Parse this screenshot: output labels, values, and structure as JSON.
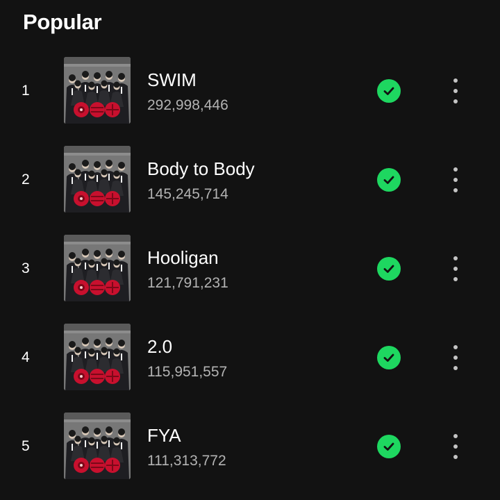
{
  "section": {
    "title": "Popular"
  },
  "tracks": [
    {
      "rank": "1",
      "title": "SWIM",
      "plays": "292,998,446",
      "downloaded": true
    },
    {
      "rank": "2",
      "title": "Body to Body",
      "plays": "145,245,714",
      "downloaded": true
    },
    {
      "rank": "3",
      "title": "Hooligan",
      "plays": "121,791,231",
      "downloaded": true
    },
    {
      "rank": "4",
      "title": "2.0",
      "plays": "115,951,557",
      "downloaded": true
    },
    {
      "rank": "5",
      "title": "FYA",
      "plays": "111,313,772",
      "downloaded": true
    }
  ],
  "icons": {
    "downloaded": "check-circle-icon",
    "more": "more-vertical-icon",
    "cover": "album-cover-art"
  },
  "colors": {
    "background": "#121212",
    "accent": "#1ed760",
    "secondary_text": "#b3b3b3"
  }
}
